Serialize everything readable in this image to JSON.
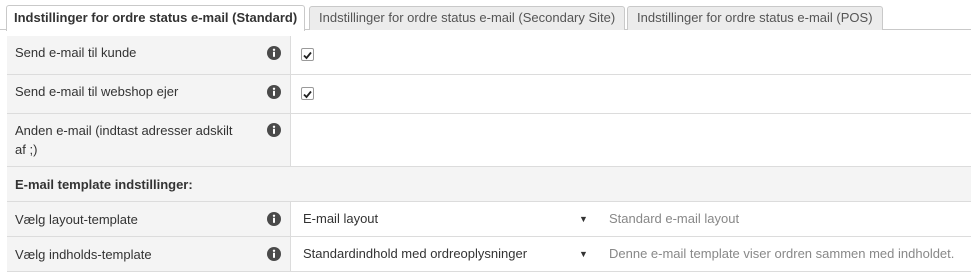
{
  "tabs": [
    {
      "label": "Indstillinger for ordre status e-mail (Standard)",
      "active": true
    },
    {
      "label": "Indstillinger for ordre status e-mail (Secondary Site)",
      "active": false
    },
    {
      "label": "Indstillinger for ordre status e-mail (POS)",
      "active": false
    }
  ],
  "settings": {
    "send_to_customer": {
      "label": "Send e-mail til kunde",
      "checked": true
    },
    "send_to_owner": {
      "label": "Send e-mail til webshop ejer",
      "checked": true
    },
    "other_email": {
      "label": "Anden e-mail (indtast adresser adskilt af ;)",
      "value": ""
    }
  },
  "template_section": {
    "title": "E-mail template indstillinger:",
    "layout": {
      "label": "Vælg layout-template",
      "selected": "E-mail layout",
      "description": "Standard e-mail layout"
    },
    "content": {
      "label": "Vælg indholds-template",
      "selected": "Standardindhold med ordreoplysninger",
      "description": "Denne e-mail template viser ordren sammen med indholdet."
    }
  },
  "icons": {
    "info": "info-circle-icon",
    "checkmark": "checkmark-icon",
    "dropdown": "caret-down-icon"
  },
  "colors": {
    "label_background": "#f4f4f4",
    "icon": "#4a4a4a",
    "border": "#dcdcdc"
  }
}
